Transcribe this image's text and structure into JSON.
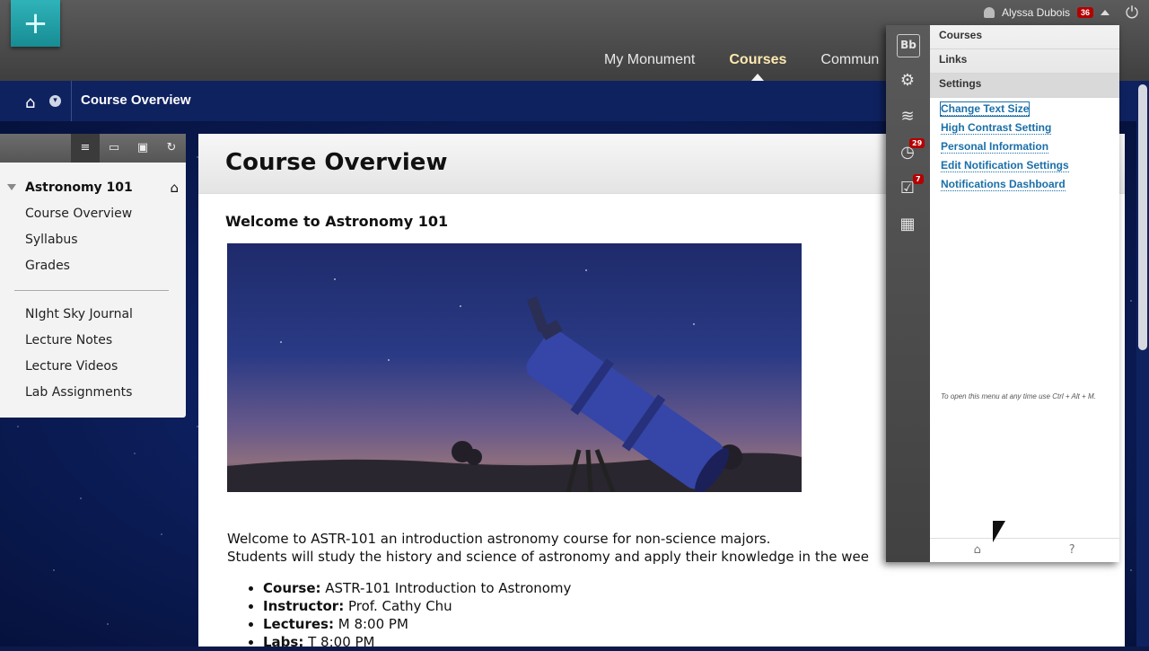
{
  "header": {
    "create_symbol": "+",
    "tabs": [
      {
        "label": "My Monument"
      },
      {
        "label": "Courses"
      },
      {
        "label": "Commun"
      }
    ],
    "user_name": "Alyssa Dubois",
    "notification_count": "36"
  },
  "breadcrumb": {
    "title": "Course Overview"
  },
  "course_menu": {
    "course_name": "Astronomy 101",
    "items": [
      "Course Overview",
      "Syllabus",
      "Grades"
    ],
    "items2": [
      "NIght Sky Journal",
      "Lecture Notes",
      "Lecture Videos",
      "Lab Assignments"
    ]
  },
  "content": {
    "page_title": "Course Overview",
    "welcome_heading": "Welcome to Astronomy 101",
    "intro_line1": "Welcome to ASTR-101 an introduction astronomy course for non-science majors.",
    "intro_line2": "Students will study the history and science of astronomy and apply their knowledge in the wee",
    "details": [
      {
        "label": "Course:",
        "value": " ASTR-101 Introduction to Astronomy"
      },
      {
        "label": "Instructor:",
        "value": " Prof. Cathy Chu"
      },
      {
        "label": "Lectures:",
        "value": " M 8:00 PM"
      },
      {
        "label": "Labs:",
        "value": " T 8:00 PM"
      }
    ]
  },
  "quick_links": {
    "icon_logo": "Bb",
    "badge_due": "29",
    "badge_tasks": "7",
    "nav": [
      "Courses",
      "Links",
      "Settings"
    ],
    "settings_links": [
      "Change Text Size",
      "High Contrast Setting",
      "Personal Information",
      "Edit Notification Settings",
      "Notifications Dashboard"
    ],
    "hint": "To open this menu at any time use Ctrl + Alt + M.",
    "footer_help": "?"
  }
}
